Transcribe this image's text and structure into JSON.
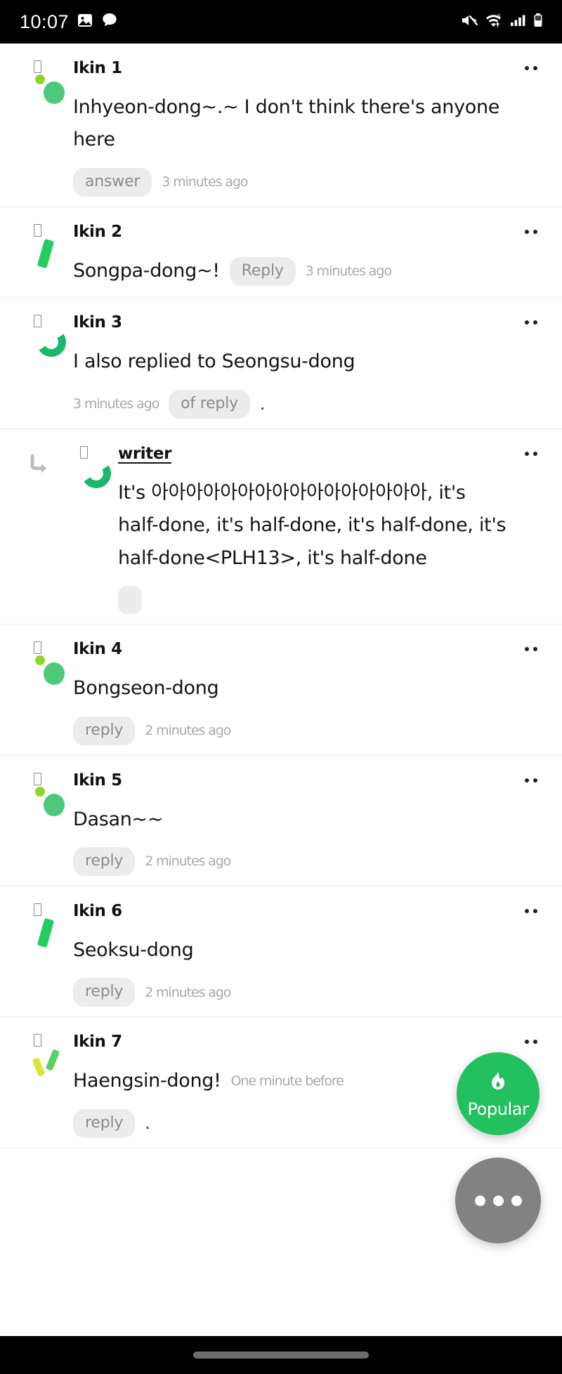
{
  "statusbar": {
    "time": "10:07",
    "left_icons": [
      "image-icon",
      "chat-bubble-icon"
    ],
    "right_icons": [
      "mute-icon",
      "wifi-6-icon",
      "cellular-signal-icon",
      "battery-icon"
    ]
  },
  "comments": [
    {
      "author": "Ikin 1",
      "avatar": "dots",
      "text": "Inhyeon-dong~.~ I don't think there's anyone here",
      "chip": "answer",
      "time": "3 minutes ago",
      "inline": false,
      "nested": false,
      "trailing_dot": false
    },
    {
      "author": "Ikin 2",
      "avatar": "bar",
      "text": "Songpa-dong~!",
      "chip": "Reply",
      "time": "3 minutes ago",
      "inline": true,
      "nested": false,
      "trailing_dot": false
    },
    {
      "author": "Ikin 3",
      "avatar": "arc",
      "text": "I also replied to Seongsu-dong",
      "chip": "of reply",
      "time": "3 minutes ago",
      "inline": false,
      "nested": false,
      "time_first": true,
      "trailing_dot": true
    },
    {
      "author": "writer",
      "avatar": "arc",
      "text": "It's 아아아아아아아아아아아아아아아아, it's half-done, it's half-done, it's half-done, it's half-done<PLH13>, it's half-done",
      "chip": "",
      "time": "",
      "inline": false,
      "nested": true,
      "is_writer": true,
      "blank_chip": true,
      "trailing_dot": false
    },
    {
      "author": "Ikin 4",
      "avatar": "dots",
      "text": "Bongseon-dong",
      "chip": "reply",
      "time": "2 minutes ago",
      "inline": false,
      "nested": false,
      "trailing_dot": false
    },
    {
      "author": "Ikin 5",
      "avatar": "dots",
      "text": "Dasan~~",
      "chip": "reply",
      "time": "2 minutes ago",
      "inline": false,
      "nested": false,
      "trailing_dot": false
    },
    {
      "author": "Ikin 6",
      "avatar": "bar",
      "text": "Seoksu-dong",
      "chip": "reply",
      "time": "2 minutes ago",
      "inline": false,
      "nested": false,
      "trailing_dot": false
    },
    {
      "author": "Ikin 7",
      "avatar": "ticks",
      "text": "Haengsin-dong!",
      "chip": "reply",
      "time": "One minute before",
      "inline": true,
      "nested": false,
      "trailing_dot": true
    }
  ],
  "fab": {
    "popular_label": "Popular",
    "popular_icon": "flame-icon",
    "popular_color": "#22c05e",
    "more_icon": "ellipsis-icon",
    "more_color": "#828282"
  },
  "colors": {
    "accent_green": "#22c05e",
    "chip_bg": "#ececec",
    "chip_text": "#8b8b8b",
    "time_text": "#a9a9a9",
    "divider": "#eeeeee"
  }
}
